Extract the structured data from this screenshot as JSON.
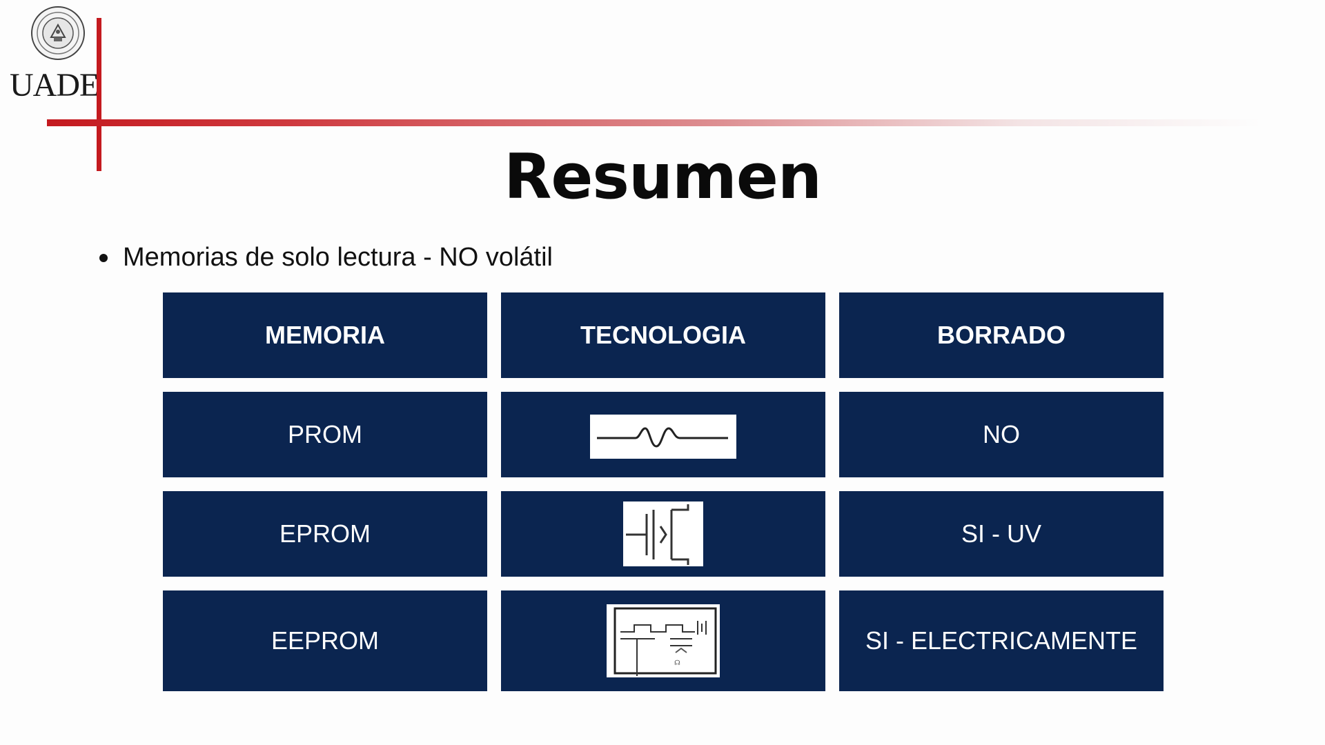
{
  "logo": {
    "name": "UADE",
    "seal_icon": "university-seal-icon"
  },
  "slide": {
    "title": "Resumen",
    "bullet": "Memorias de solo lectura - NO volátil"
  },
  "colors": {
    "accent_red": "#c41a1f",
    "cell_bg": "#0b2550",
    "text_light": "#ffffff"
  },
  "table": {
    "headers": [
      "MEMORIA",
      "TECNOLOGIA",
      "BORRADO"
    ],
    "rows": [
      {
        "memoria": "PROM",
        "tecnologia_icon": "fuse-symbol-icon",
        "borrado": "NO"
      },
      {
        "memoria": "EPROM",
        "tecnologia_icon": "floating-gate-transistor-icon",
        "borrado": "SI - UV"
      },
      {
        "memoria": "EEPROM",
        "tecnologia_icon": "eeprom-cell-circuit-icon",
        "borrado": "SI - ELECTRICAMENTE"
      }
    ]
  }
}
